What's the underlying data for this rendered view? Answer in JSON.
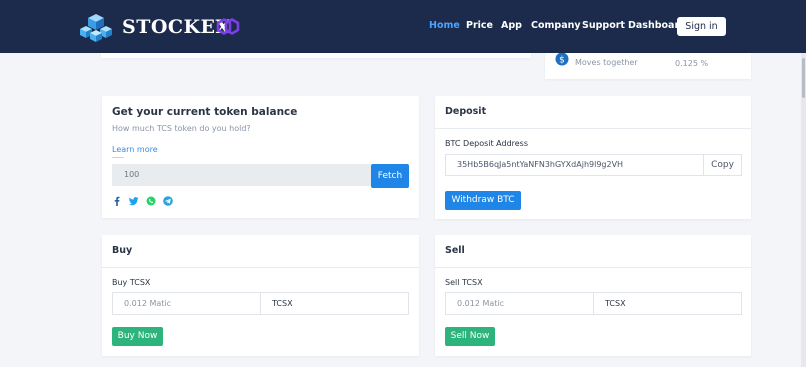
{
  "brand": {
    "name": "STOCKEX",
    "accent": "#7b3fe4",
    "nav_bg": "#1c2b4b"
  },
  "nav": {
    "items": [
      "Home",
      "Price",
      "App",
      "Company",
      "Support",
      "Dashboard"
    ],
    "active": "Home",
    "signin_label": "Sign in"
  },
  "top_info": {
    "label": "Moves together",
    "value": "0.125 %"
  },
  "balance": {
    "title": "Get your current token balance",
    "subtitle": "How much TCS token do you hold?",
    "learn_more": "Learn more",
    "input_value": "100",
    "fetch_label": "Fetch",
    "social_icons": [
      "facebook-icon",
      "twitter-icon",
      "whatsapp-icon",
      "telegram-icon"
    ]
  },
  "deposit": {
    "title": "Deposit",
    "address_label": "BTC Deposit Address",
    "address": "35Hb5B6qJa5ntYaNFN3hGYXdAjh9l9g2VH",
    "copy_label": "Copy",
    "withdraw_label": "Withdraw BTC"
  },
  "buy": {
    "title": "Buy",
    "field_label": "Buy TCSX",
    "placeholder": "0.012  Matic",
    "unit": "TCSX",
    "button_label": "Buy Now"
  },
  "sell": {
    "title": "Sell",
    "field_label": "Sell TCSX",
    "placeholder": "0.012  Matic",
    "unit": "TCSX",
    "button_label": "Sell Now"
  },
  "colors": {
    "primary_blue": "#1f85e6",
    "green": "#2db47d",
    "active_nav": "#4aa3ff"
  }
}
